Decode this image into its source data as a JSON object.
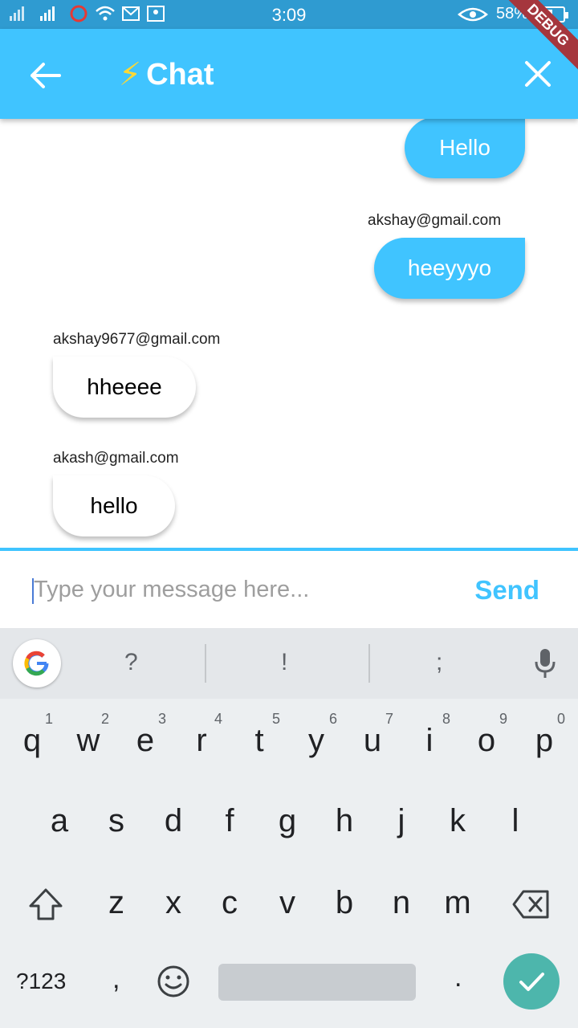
{
  "status_bar": {
    "time": "3:09",
    "battery_text": "58%",
    "battery_level": 0.58
  },
  "app_bar": {
    "title": "Chat",
    "title_icon": "⚡",
    "debug_banner": "DEBUG"
  },
  "messages": [
    {
      "sender": "",
      "text": "Hello",
      "mine": true
    },
    {
      "sender": "akshay@gmail.com",
      "text": "heeyyyo",
      "mine": true
    },
    {
      "sender": "akshay9677@gmail.com",
      "text": "hheeee",
      "mine": false
    },
    {
      "sender": "akash@gmail.com",
      "text": "hello",
      "mine": false
    }
  ],
  "composer": {
    "placeholder": "Type your message here...",
    "send_label": "Send"
  },
  "keyboard": {
    "suggestions": [
      "?",
      "!",
      ";"
    ],
    "row1": [
      {
        "key": "q",
        "num": "1"
      },
      {
        "key": "w",
        "num": "2"
      },
      {
        "key": "e",
        "num": "3"
      },
      {
        "key": "r",
        "num": "4"
      },
      {
        "key": "t",
        "num": "5"
      },
      {
        "key": "y",
        "num": "6"
      },
      {
        "key": "u",
        "num": "7"
      },
      {
        "key": "i",
        "num": "8"
      },
      {
        "key": "o",
        "num": "9"
      },
      {
        "key": "p",
        "num": "0"
      }
    ],
    "row2": [
      "a",
      "s",
      "d",
      "f",
      "g",
      "h",
      "j",
      "k",
      "l"
    ],
    "row3": [
      "z",
      "x",
      "c",
      "v",
      "b",
      "n",
      "m"
    ],
    "symbols_label": "?123",
    "comma": ",",
    "period": "."
  },
  "colors": {
    "accent": "#40c4ff",
    "status_bar": "#2f9bd1",
    "enter_key": "#4db6ac"
  }
}
